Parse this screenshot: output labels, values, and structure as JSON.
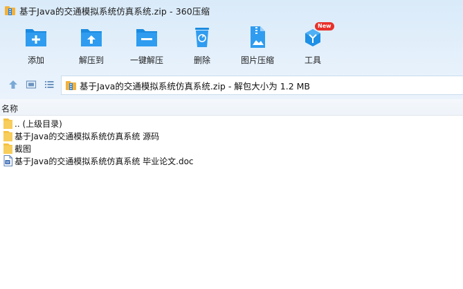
{
  "window": {
    "title": "基于Java的交通模拟系统仿真系统.zip - 360压缩"
  },
  "toolbar": {
    "items": [
      {
        "label": "添加",
        "icon": "add-folder-icon"
      },
      {
        "label": "解压到",
        "icon": "extract-to-icon"
      },
      {
        "label": "一键解压",
        "icon": "one-click-extract-icon"
      },
      {
        "label": "删除",
        "icon": "recycle-bin-icon"
      },
      {
        "label": "图片压缩",
        "icon": "image-compress-icon"
      },
      {
        "label": "工具",
        "icon": "tools-icon",
        "badge": "New"
      }
    ]
  },
  "address": {
    "text": "基于Java的交通模拟系统仿真系统.zip - 解包大小为 1.2 MB"
  },
  "columns": {
    "name": "名称"
  },
  "files": [
    {
      "name": ".. (上级目录)",
      "icon": "folder-icon"
    },
    {
      "name": "基于Java的交通模拟系统仿真系统 源码",
      "icon": "folder-icon"
    },
    {
      "name": "截图",
      "icon": "folder-icon"
    },
    {
      "name": "基于Java的交通模拟系统仿真系统 毕业论文.doc",
      "icon": "word-document-icon"
    }
  ],
  "colors": {
    "accent": "#1e90e6",
    "badge": "#e8302a",
    "folder": "#f5c242"
  }
}
